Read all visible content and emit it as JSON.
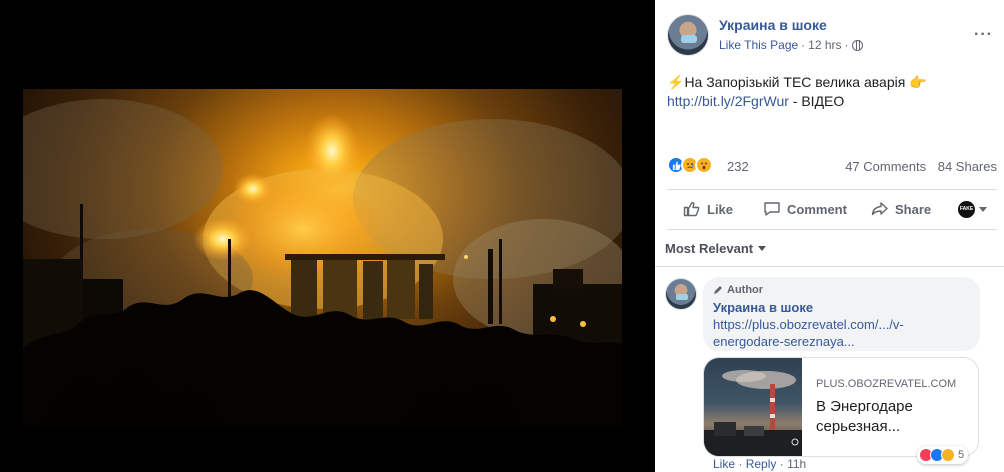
{
  "post": {
    "page_name": "Украина в шоке",
    "like_link": "Like This Page",
    "separator": "·",
    "time": "12 hrs",
    "text_line1": "На Запорізькій ТЕС велика аварія",
    "url": "http://bit.ly/2FgrWur",
    "text_suffix": " - ВІДЕО",
    "lightning_emoji": "⚡",
    "pointing_emoji": "👉"
  },
  "stats": {
    "reaction_count": "232",
    "comments": "47 Comments",
    "shares": "84 Shares"
  },
  "actions": {
    "like": "Like",
    "comment": "Comment",
    "share": "Share",
    "fake_badge": "FAKE"
  },
  "comments_sort": "Most Relevant",
  "comment": {
    "author_badge": "Author",
    "name": "Украина в шоке",
    "link": "https://plus.obozrevatel.com/.../v-energodare-sereznaya...",
    "link_line1": "https://plus.obozrevatel.com/.../v-",
    "link_line2": "energodare-sereznaya...",
    "preview": {
      "domain": "PLUS.OBOZREVATEL.COM",
      "title": "В Энергодаре серьезная..."
    },
    "like": "Like",
    "reply": "Reply",
    "dot": "·",
    "time": "11h",
    "reaction_count": "5"
  },
  "colors": {
    "link": "#385898",
    "like_blue": "#1877f2",
    "emoji_yellow": "#f7b125",
    "love_red": "#f33e58",
    "fire_orange": "#f5a623"
  },
  "icons": [
    "globe-icon",
    "more-icon",
    "like-thumb-icon",
    "comment-icon",
    "share-icon",
    "pencil-icon",
    "caret-down-icon"
  ]
}
